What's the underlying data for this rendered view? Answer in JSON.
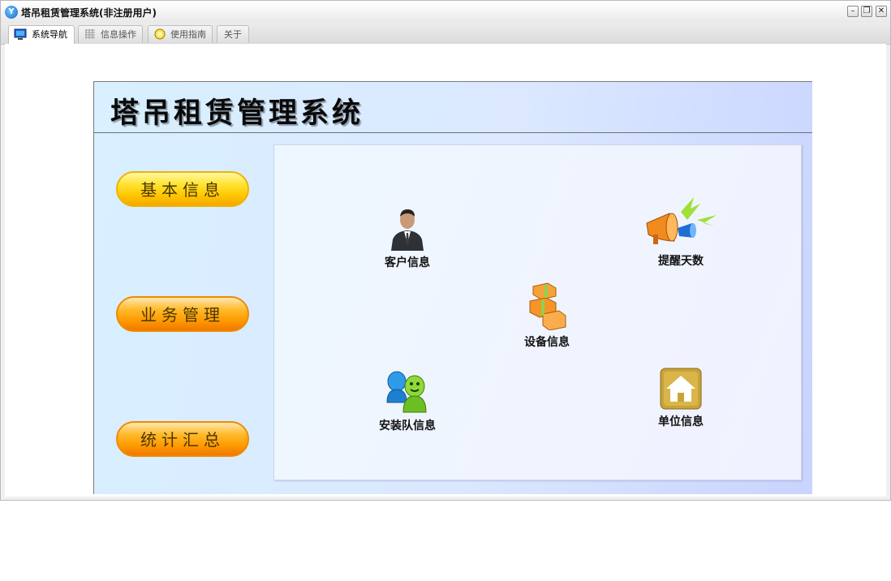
{
  "window": {
    "title": "塔吊租赁管理系统(非注册用户)",
    "controls": {
      "minimize": "–",
      "restore": "❐",
      "close": "✕"
    }
  },
  "tabs": [
    {
      "label": "系统导航",
      "icon": "monitor-icon",
      "active": true
    },
    {
      "label": "信息操作",
      "icon": "grid-icon",
      "active": false
    },
    {
      "label": "使用指南",
      "icon": "guide-icon",
      "active": false
    },
    {
      "label": "关于",
      "icon": "",
      "active": false
    }
  ],
  "header": {
    "title": "塔吊租赁管理系统"
  },
  "nav": [
    {
      "label": "基本信息",
      "style": "yellow"
    },
    {
      "label": "业务管理",
      "style": "orange"
    },
    {
      "label": "统计汇总",
      "style": "orange"
    }
  ],
  "items": [
    {
      "label": "客户信息",
      "icon": "customer-icon"
    },
    {
      "label": "提醒天数",
      "icon": "megaphone-icon"
    },
    {
      "label": "设备信息",
      "icon": "boxes-icon"
    },
    {
      "label": "安装队信息",
      "icon": "team-icon"
    },
    {
      "label": "单位信息",
      "icon": "house-icon"
    }
  ],
  "colors": {
    "accent": "#ffc600",
    "panel": "#d8f0ff"
  }
}
